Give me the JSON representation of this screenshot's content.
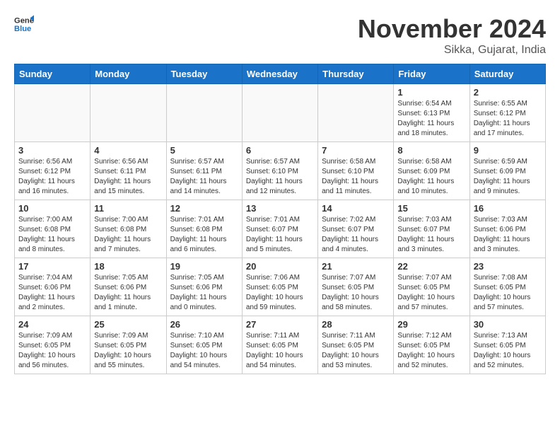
{
  "header": {
    "logo_line1": "General",
    "logo_line2": "Blue",
    "month": "November 2024",
    "location": "Sikka, Gujarat, India"
  },
  "weekdays": [
    "Sunday",
    "Monday",
    "Tuesday",
    "Wednesday",
    "Thursday",
    "Friday",
    "Saturday"
  ],
  "weeks": [
    [
      {
        "day": "",
        "info": ""
      },
      {
        "day": "",
        "info": ""
      },
      {
        "day": "",
        "info": ""
      },
      {
        "day": "",
        "info": ""
      },
      {
        "day": "",
        "info": ""
      },
      {
        "day": "1",
        "info": "Sunrise: 6:54 AM\nSunset: 6:13 PM\nDaylight: 11 hours\nand 18 minutes."
      },
      {
        "day": "2",
        "info": "Sunrise: 6:55 AM\nSunset: 6:12 PM\nDaylight: 11 hours\nand 17 minutes."
      }
    ],
    [
      {
        "day": "3",
        "info": "Sunrise: 6:56 AM\nSunset: 6:12 PM\nDaylight: 11 hours\nand 16 minutes."
      },
      {
        "day": "4",
        "info": "Sunrise: 6:56 AM\nSunset: 6:11 PM\nDaylight: 11 hours\nand 15 minutes."
      },
      {
        "day": "5",
        "info": "Sunrise: 6:57 AM\nSunset: 6:11 PM\nDaylight: 11 hours\nand 14 minutes."
      },
      {
        "day": "6",
        "info": "Sunrise: 6:57 AM\nSunset: 6:10 PM\nDaylight: 11 hours\nand 12 minutes."
      },
      {
        "day": "7",
        "info": "Sunrise: 6:58 AM\nSunset: 6:10 PM\nDaylight: 11 hours\nand 11 minutes."
      },
      {
        "day": "8",
        "info": "Sunrise: 6:58 AM\nSunset: 6:09 PM\nDaylight: 11 hours\nand 10 minutes."
      },
      {
        "day": "9",
        "info": "Sunrise: 6:59 AM\nSunset: 6:09 PM\nDaylight: 11 hours\nand 9 minutes."
      }
    ],
    [
      {
        "day": "10",
        "info": "Sunrise: 7:00 AM\nSunset: 6:08 PM\nDaylight: 11 hours\nand 8 minutes."
      },
      {
        "day": "11",
        "info": "Sunrise: 7:00 AM\nSunset: 6:08 PM\nDaylight: 11 hours\nand 7 minutes."
      },
      {
        "day": "12",
        "info": "Sunrise: 7:01 AM\nSunset: 6:08 PM\nDaylight: 11 hours\nand 6 minutes."
      },
      {
        "day": "13",
        "info": "Sunrise: 7:01 AM\nSunset: 6:07 PM\nDaylight: 11 hours\nand 5 minutes."
      },
      {
        "day": "14",
        "info": "Sunrise: 7:02 AM\nSunset: 6:07 PM\nDaylight: 11 hours\nand 4 minutes."
      },
      {
        "day": "15",
        "info": "Sunrise: 7:03 AM\nSunset: 6:07 PM\nDaylight: 11 hours\nand 3 minutes."
      },
      {
        "day": "16",
        "info": "Sunrise: 7:03 AM\nSunset: 6:06 PM\nDaylight: 11 hours\nand 3 minutes."
      }
    ],
    [
      {
        "day": "17",
        "info": "Sunrise: 7:04 AM\nSunset: 6:06 PM\nDaylight: 11 hours\nand 2 minutes."
      },
      {
        "day": "18",
        "info": "Sunrise: 7:05 AM\nSunset: 6:06 PM\nDaylight: 11 hours\nand 1 minute."
      },
      {
        "day": "19",
        "info": "Sunrise: 7:05 AM\nSunset: 6:06 PM\nDaylight: 11 hours\nand 0 minutes."
      },
      {
        "day": "20",
        "info": "Sunrise: 7:06 AM\nSunset: 6:05 PM\nDaylight: 10 hours\nand 59 minutes."
      },
      {
        "day": "21",
        "info": "Sunrise: 7:07 AM\nSunset: 6:05 PM\nDaylight: 10 hours\nand 58 minutes."
      },
      {
        "day": "22",
        "info": "Sunrise: 7:07 AM\nSunset: 6:05 PM\nDaylight: 10 hours\nand 57 minutes."
      },
      {
        "day": "23",
        "info": "Sunrise: 7:08 AM\nSunset: 6:05 PM\nDaylight: 10 hours\nand 57 minutes."
      }
    ],
    [
      {
        "day": "24",
        "info": "Sunrise: 7:09 AM\nSunset: 6:05 PM\nDaylight: 10 hours\nand 56 minutes."
      },
      {
        "day": "25",
        "info": "Sunrise: 7:09 AM\nSunset: 6:05 PM\nDaylight: 10 hours\nand 55 minutes."
      },
      {
        "day": "26",
        "info": "Sunrise: 7:10 AM\nSunset: 6:05 PM\nDaylight: 10 hours\nand 54 minutes."
      },
      {
        "day": "27",
        "info": "Sunrise: 7:11 AM\nSunset: 6:05 PM\nDaylight: 10 hours\nand 54 minutes."
      },
      {
        "day": "28",
        "info": "Sunrise: 7:11 AM\nSunset: 6:05 PM\nDaylight: 10 hours\nand 53 minutes."
      },
      {
        "day": "29",
        "info": "Sunrise: 7:12 AM\nSunset: 6:05 PM\nDaylight: 10 hours\nand 52 minutes."
      },
      {
        "day": "30",
        "info": "Sunrise: 7:13 AM\nSunset: 6:05 PM\nDaylight: 10 hours\nand 52 minutes."
      }
    ]
  ]
}
